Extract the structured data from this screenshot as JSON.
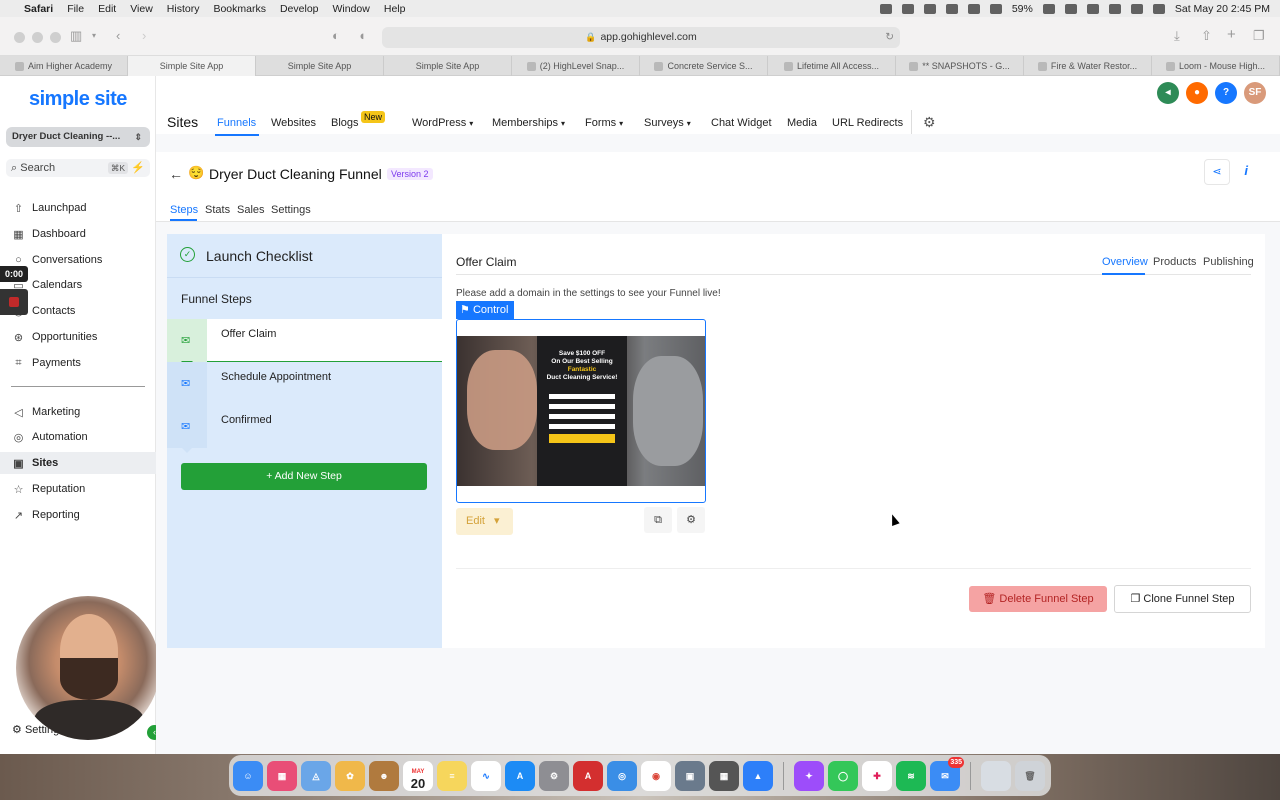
{
  "menubar": {
    "app_name": "Safari",
    "items": [
      "File",
      "Edit",
      "View",
      "History",
      "Bookmarks",
      "Develop",
      "Window",
      "Help"
    ],
    "battery": "59%",
    "datetime": "Sat May 20  2:45 PM"
  },
  "browser": {
    "url": "app.gohighlevel.com",
    "tabs": [
      "Aim Higher Academy",
      "Simple Site App",
      "Simple Site App",
      "Simple Site App",
      "(2) HighLevel Snap...",
      "Concrete Service S...",
      "Lifetime All Access...",
      "** SNAPSHOTS - G...",
      "Fire & Water Restor...",
      "Loom - Mouse High..."
    ],
    "active_tab_index": 1
  },
  "sidebar": {
    "logo": "simple site",
    "account": "Dryer Duct Cleaning --...",
    "search_label": "Search",
    "search_shortcut": "⌘K",
    "items": [
      {
        "label": "Launchpad",
        "icon": "rocket-icon"
      },
      {
        "label": "Dashboard",
        "icon": "dashboard-icon"
      },
      {
        "label": "Conversations",
        "icon": "chat-icon"
      },
      {
        "label": "Calendars",
        "icon": "calendar-icon"
      },
      {
        "label": "Contacts",
        "icon": "contacts-icon"
      },
      {
        "label": "Opportunities",
        "icon": "target-icon"
      },
      {
        "label": "Payments",
        "icon": "payments-icon"
      },
      {
        "label": "Marketing",
        "icon": "megaphone-icon"
      },
      {
        "label": "Automation",
        "icon": "automation-icon"
      },
      {
        "label": "Sites",
        "icon": "globe-icon"
      },
      {
        "label": "Reputation",
        "icon": "star-icon"
      },
      {
        "label": "Reporting",
        "icon": "chart-icon"
      }
    ],
    "active_item": "Sites",
    "settings_label": "Settings"
  },
  "recording": {
    "time": "0:00"
  },
  "topnav": {
    "title": "Sites",
    "items": [
      "Funnels",
      "Websites",
      "Blogs",
      "WordPress",
      "Memberships",
      "Forms",
      "Surveys",
      "Chat Widget",
      "Media",
      "URL Redirects"
    ],
    "new_badge": "New",
    "user_initials": "SF"
  },
  "funnel": {
    "name": "Dryer Duct Cleaning Funnel",
    "version": "Version 2",
    "tabs": [
      "Steps",
      "Stats",
      "Sales",
      "Settings"
    ],
    "active_tab": "Steps"
  },
  "checklist": {
    "label": "Launch Checklist"
  },
  "funnel_steps": {
    "title": "Funnel Steps",
    "steps": [
      "Offer Claim",
      "Schedule Appointment",
      "Confirmed"
    ],
    "active_step": "Offer Claim",
    "add_button": "Add New Step"
  },
  "step_detail": {
    "title": "Offer Claim",
    "tabs": [
      "Overview",
      "Products",
      "Publishing"
    ],
    "active_tab": "Overview",
    "domain_message": "Please add a domain in the settings to see your Funnel live!",
    "control_label": "Control",
    "preview_headline": "Save $100 OFF",
    "preview_headline_rest": "On Our Best Selling",
    "preview_highlight": "Fantastic",
    "preview_sub": "Duct Cleaning Service!",
    "edit_label": "Edit",
    "delete_label": "Delete Funnel Step",
    "clone_label": "Clone Funnel Step"
  },
  "dock": {
    "calendar_day": "20",
    "calendar_month": "MAY",
    "mail_badge": "335"
  },
  "colors": {
    "brand_blue": "#1677ff",
    "green": "#23a038",
    "delete_red": "#f5a3a3"
  }
}
